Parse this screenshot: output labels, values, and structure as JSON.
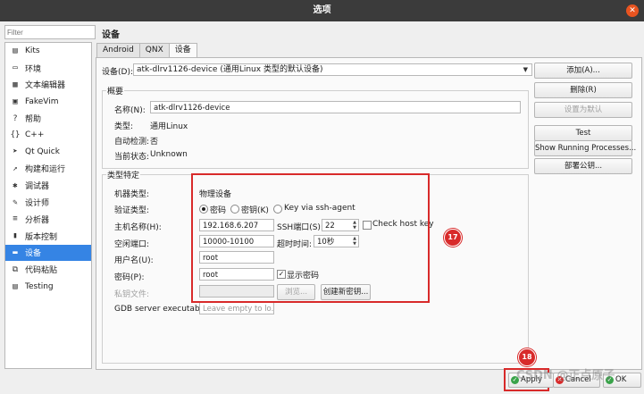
{
  "window": {
    "title": "选项"
  },
  "sidebar": {
    "filter_placeholder": "Filter",
    "items": [
      {
        "label": "Kits",
        "icon": "kits-icon",
        "glyph": "▤"
      },
      {
        "label": "环境",
        "icon": "monitor-icon",
        "glyph": "▭"
      },
      {
        "label": "文本编辑器",
        "icon": "text-editor-icon",
        "glyph": "▦"
      },
      {
        "label": "FakeVim",
        "icon": "fakevim-icon",
        "glyph": "▣"
      },
      {
        "label": "帮助",
        "icon": "help-icon",
        "glyph": "?"
      },
      {
        "label": "C++",
        "icon": "cpp-icon",
        "glyph": "{}"
      },
      {
        "label": "Qt Quick",
        "icon": "qtquick-icon",
        "glyph": "➤"
      },
      {
        "label": "构建和运行",
        "icon": "build-icon",
        "glyph": "↗"
      },
      {
        "label": "调试器",
        "icon": "debugger-icon",
        "glyph": "✱"
      },
      {
        "label": "设计师",
        "icon": "designer-icon",
        "glyph": "✎"
      },
      {
        "label": "分析器",
        "icon": "analyzer-icon",
        "glyph": "≡"
      },
      {
        "label": "版本控制",
        "icon": "version-control-icon",
        "glyph": "▮"
      },
      {
        "label": "设备",
        "icon": "devices-icon",
        "glyph": "▬"
      },
      {
        "label": "代码粘贴",
        "icon": "code-paste-icon",
        "glyph": "⧉"
      },
      {
        "label": "Testing",
        "icon": "testing-icon",
        "glyph": "▤"
      }
    ],
    "selected_index": 12
  },
  "main": {
    "heading": "设备",
    "tabs": [
      "Android",
      "QNX",
      "设备"
    ],
    "active_tab": 2,
    "device_label": "设备(D):",
    "device_value": "atk-dlrv1126-device (通用Linux 类型的默认设备)",
    "side_buttons": [
      "添加(A)...",
      "删除(R)",
      "设置为默认",
      "Test",
      "Show Running Processes...",
      "部署公钥..."
    ],
    "overview": {
      "title": "概要",
      "name_label": "名称(N):",
      "name_value": "atk-dlrv1126-device",
      "type_label": "类型:",
      "type_value": "通用Linux",
      "autodetect_label": "自动检测:",
      "autodetect_value": "否",
      "state_label": "当前状态:",
      "state_value": "Unknown"
    },
    "specific": {
      "title": "类型特定",
      "machine_type_label": "机器类型:",
      "machine_type_value": "物理设备",
      "auth_label": "验证类型:",
      "auth_options": [
        "密码",
        "密钥(K)",
        "Key via ssh-agent"
      ],
      "auth_selected": 0,
      "host_label": "主机名称(H):",
      "host_value": "192.168.6.207",
      "ssh_port_label": "SSH端口(S):",
      "ssh_port_value": "22",
      "check_host_key_label": "Check host key",
      "check_host_key_checked": false,
      "free_ports_label": "空闲端口:",
      "free_ports_value": "10000-10100",
      "timeout_label": "超时时间:",
      "timeout_value": "10秒",
      "user_label": "用户名(U):",
      "user_value": "root",
      "password_label": "密码(P):",
      "password_value": "root",
      "show_password_label": "显示密码",
      "show_password_checked": true,
      "private_key_label": "私钥文件:",
      "browse_label": "浏览...",
      "create_key_label": "创建新密钥...",
      "gdb_label": "GDB server executable:",
      "gdb_placeholder": "Leave empty to lo..."
    }
  },
  "annotations": {
    "badge_17": "17",
    "badge_18": "18"
  },
  "footer": {
    "apply_label": "Apply",
    "cancel_label": "Cancel",
    "ok_label": "OK"
  },
  "watermark": "CSDN @正点原子",
  "colors": {
    "selection": "#3584e4",
    "annotation_red": "#d82a2a",
    "titlebar": "#3b3b3b",
    "close": "#e95420"
  }
}
